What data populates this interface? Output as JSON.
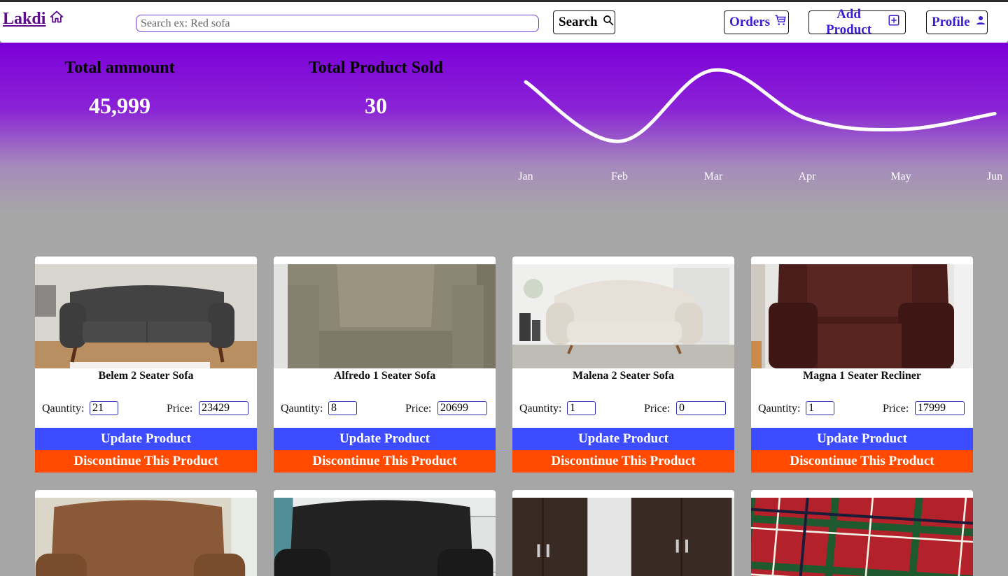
{
  "navbar": {
    "brand": "Lakdi",
    "search_placeholder": "Search ex: Red sofa",
    "search_button": "Search",
    "orders_button": "Orders",
    "add_product_button": "Add Product",
    "profile_button": "Profile"
  },
  "stats": {
    "total_amount_label": "Total ammount",
    "total_amount_value": "45,999",
    "total_sold_label": "Total Product Sold",
    "total_sold_value": "30"
  },
  "chart_data": {
    "type": "line",
    "categories": [
      "Jan",
      "Feb",
      "Mar",
      "Apr",
      "May",
      "Jun"
    ],
    "series": [
      {
        "values": [
          5.5,
          1.0,
          6.4,
          2.7,
          1.9,
          3.1
        ]
      }
    ],
    "title": "",
    "xlabel": "",
    "ylabel": "",
    "ylim": [
      0,
      7
    ],
    "grid": false,
    "line_color": "#ffffff"
  },
  "products": [
    {
      "name": "Belem 2 Seater Sofa",
      "quantity_label": "Qauntity:",
      "quantity": "21",
      "price_label": "Price:",
      "price": "23429",
      "update_label": "Update Product",
      "discontinue_label": "Discontinue This Product",
      "image": "dark-grey-2-seater-sofa"
    },
    {
      "name": "Alfredo 1 Seater Sofa",
      "quantity_label": "Qauntity:",
      "quantity": "8",
      "price_label": "Price:",
      "price": "20699",
      "update_label": "Update Product",
      "discontinue_label": "Discontinue This Product",
      "image": "olive-armchair"
    },
    {
      "name": "Malena 2 Seater Sofa",
      "quantity_label": "Qauntity:",
      "quantity": "1",
      "price_label": "Price:",
      "price": "0",
      "update_label": "Update Product",
      "discontinue_label": "Discontinue This Product",
      "image": "cream-tufted-sofa"
    },
    {
      "name": "Magna 1 Seater Recliner",
      "quantity_label": "Qauntity:",
      "quantity": "1",
      "price_label": "Price:",
      "price": "17999",
      "update_label": "Update Product",
      "discontinue_label": "Discontinue This Product",
      "image": "brown-leather-recliner"
    },
    {
      "image": "tan-leather-recliner"
    },
    {
      "image": "black-leather-recliner"
    },
    {
      "image": "dark-wardrobe"
    },
    {
      "image": "tartan-cushion"
    }
  ],
  "colors": {
    "brand": "#5c0b8a",
    "accent": "#3a1fd1",
    "update": "#3d4cff",
    "discontinue": "#ff4a00",
    "hero_top": "#7c00d8"
  }
}
